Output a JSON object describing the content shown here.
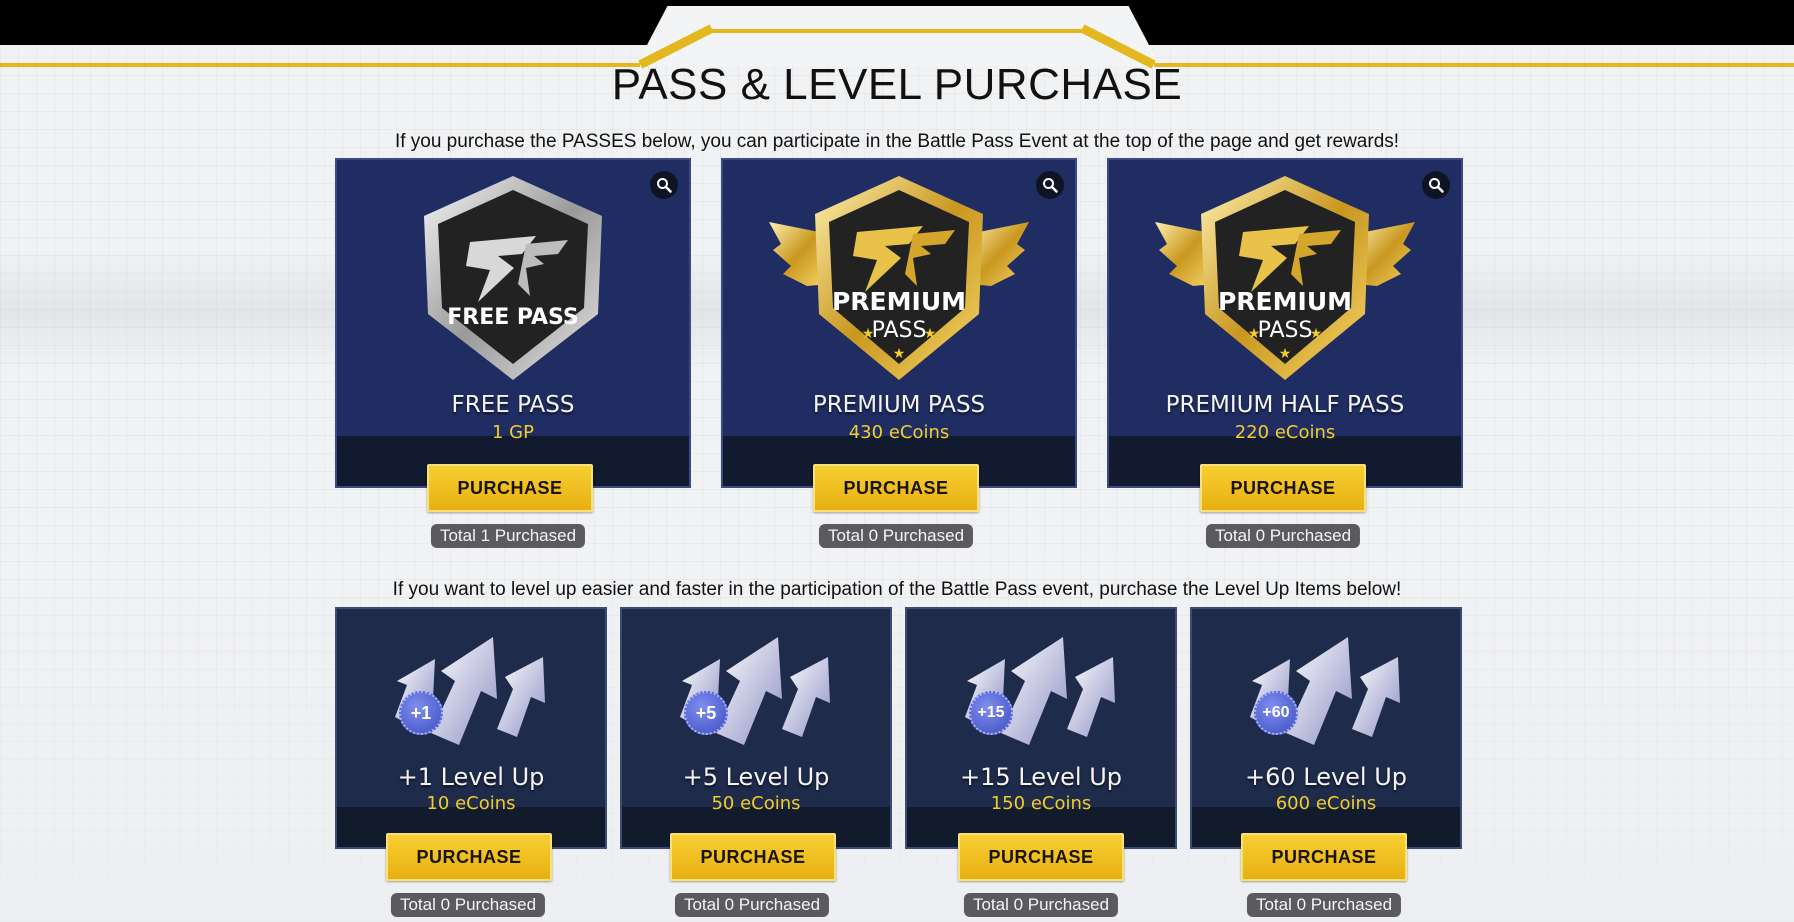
{
  "page": {
    "title": "PASS & LEVEL PURCHASE",
    "intro_passes": "If you purchase the PASSES below, you can participate in the Battle Pass Event at the top of the page and get rewards!",
    "intro_levels": "If you want to level up easier and faster in the participation of the Battle Pass event, purchase the Level Up Items below!"
  },
  "passes": [
    {
      "name": "FREE PASS",
      "price": "1 GP",
      "button": "PURCHASE",
      "purchased": "Total 1 Purchased",
      "badge_text": "FREE PASS",
      "icon": "free-pass-emblem"
    },
    {
      "name": "PREMIUM PASS",
      "price": "430 eCoins",
      "button": "PURCHASE",
      "purchased": "Total 0 Purchased",
      "badge_text": "PREMIUM",
      "badge_sub": "PASS",
      "icon": "premium-pass-emblem"
    },
    {
      "name": "PREMIUM HALF PASS",
      "price": "220 eCoins",
      "button": "PURCHASE",
      "purchased": "Total 0 Purchased",
      "badge_text": "PREMIUM",
      "badge_sub": "PASS",
      "icon": "premium-pass-emblem"
    }
  ],
  "levels": [
    {
      "name": "+1 Level Up",
      "price": "10 eCoins",
      "badge": "+1",
      "button": "PURCHASE",
      "purchased": "Total 0 Purchased"
    },
    {
      "name": "+5 Level Up",
      "price": "50 eCoins",
      "badge": "+5",
      "button": "PURCHASE",
      "purchased": "Total 0 Purchased"
    },
    {
      "name": "+15 Level Up",
      "price": "150 eCoins",
      "badge": "+15",
      "button": "PURCHASE",
      "purchased": "Total 0 Purchased"
    },
    {
      "name": "+60 Level Up",
      "price": "600 eCoins",
      "badge": "+60",
      "button": "PURCHASE",
      "purchased": "Total 0 Purchased"
    }
  ],
  "colors": {
    "accent_gold": "#e3b81f",
    "pass_card": "#1f2d63",
    "level_card": "#1e2b4a",
    "price_text": "#f2cd2a"
  }
}
